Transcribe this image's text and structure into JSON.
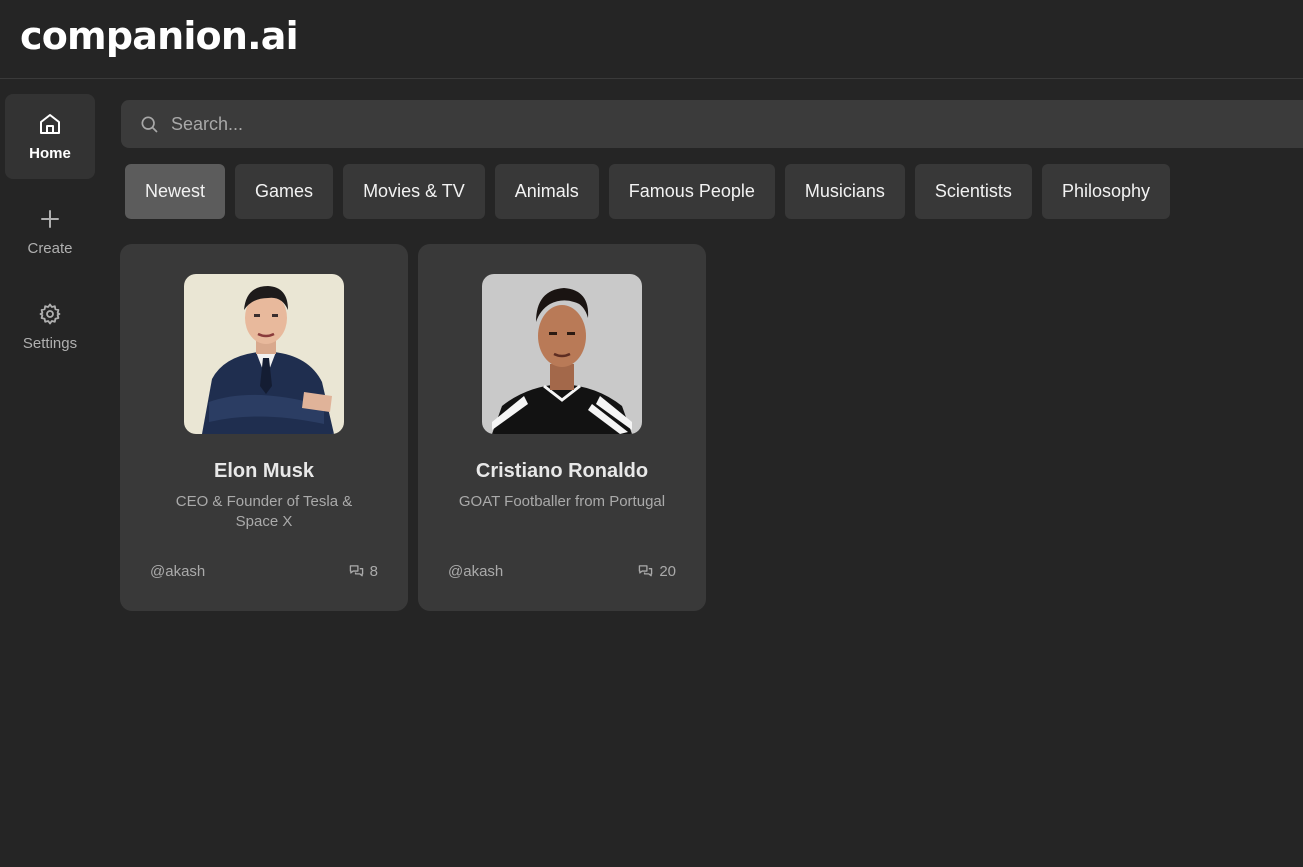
{
  "app": {
    "logo": "companion.ai"
  },
  "sidebar": {
    "items": [
      {
        "label": "Home",
        "icon": "home-icon",
        "active": true
      },
      {
        "label": "Create",
        "icon": "plus-icon",
        "active": false
      },
      {
        "label": "Settings",
        "icon": "gear-icon",
        "active": false
      }
    ]
  },
  "search": {
    "placeholder": "Search...",
    "icon": "search-icon"
  },
  "categories": [
    "Newest",
    "Games",
    "Movies & TV",
    "Animals",
    "Famous People",
    "Musicians",
    "Scientists",
    "Philosophy"
  ],
  "active_category": "Newest",
  "companions": [
    {
      "name": "Elon Musk",
      "description": "CEO & Founder of Tesla & Space X",
      "author": "@akash",
      "chats": "8",
      "chat_icon": "chat-bubbles-icon"
    },
    {
      "name": "Cristiano Ronaldo",
      "description": "GOAT Footballer from Portugal",
      "author": "@akash",
      "chats": "20",
      "chat_icon": "chat-bubbles-icon"
    }
  ],
  "colors": {
    "background": "#252525",
    "card": "#393939",
    "accent_active": "#5c5c5c"
  }
}
